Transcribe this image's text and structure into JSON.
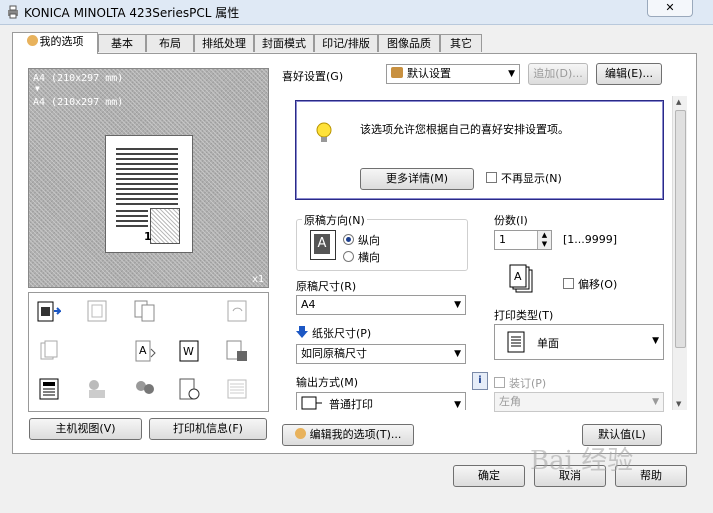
{
  "window": {
    "title": "KONICA MINOLTA 423SeriesPCL 属性",
    "close_label": "✕"
  },
  "tabs": [
    "我的选项",
    "基本",
    "布局",
    "排纸处理",
    "封面模式",
    "印记/排版",
    "图像品质",
    "其它"
  ],
  "preview": {
    "line1": "A4  (210x297 mm)",
    "arrow": "▼",
    "line2": "A4  (210x297 mm)",
    "copies_mark": "1",
    "zoom": "x1"
  },
  "left_buttons": {
    "main_view": "主机视图(V)",
    "printer_info": "打印机信息(F)"
  },
  "favorites": {
    "label": "喜好设置(G)",
    "value": "默认设置",
    "add": "追加(D)...",
    "edit": "编辑(E)..."
  },
  "tip": {
    "text": "该选项允许您根据自己的喜好安排设置项。",
    "more": "更多详情(M)",
    "no_show": "不再显示(N)"
  },
  "orientation": {
    "title": "原稿方向(N)",
    "portrait": "纵向",
    "landscape": "横向",
    "icon_letter": "A"
  },
  "copies": {
    "label": "份数(I)",
    "value": "1",
    "range": "[1...9999]"
  },
  "offset": {
    "label": "偏移(O)"
  },
  "original_size": {
    "label": "原稿尺寸(R)",
    "value": "A4"
  },
  "paper_size": {
    "label": "纸张尺寸(P)",
    "value": "如同原稿尺寸"
  },
  "print_type": {
    "label": "打印类型(T)",
    "value": "单面"
  },
  "output_method": {
    "label": "输出方式(M)",
    "value": "普通打印"
  },
  "binding": {
    "label": "装订(P)",
    "value": "左角"
  },
  "bottom": {
    "edit_my": "编辑我的选项(T)...",
    "default": "默认值(L)"
  },
  "dialog": {
    "ok": "确定",
    "cancel": "取消",
    "help": "帮助"
  },
  "watermark": "Bai 经验"
}
